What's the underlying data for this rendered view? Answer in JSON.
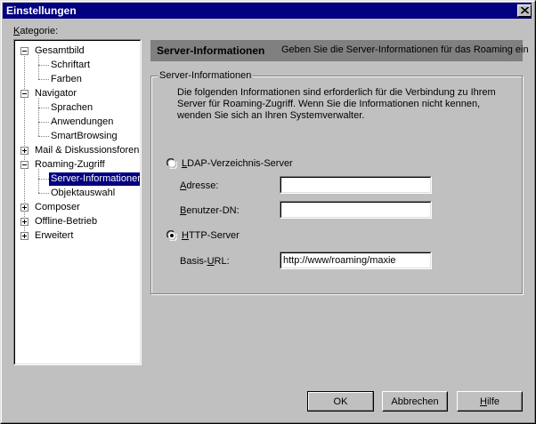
{
  "window": {
    "title": "Einstellungen"
  },
  "kategorie_label": "Kategorie:",
  "tree": {
    "gesamtbild": "Gesamtbild",
    "schriftart": "Schriftart",
    "farben": "Farben",
    "navigator": "Navigator",
    "sprachen": "Sprachen",
    "anwendungen": "Anwendungen",
    "smartbrowsing": "SmartBrowsing",
    "mail": "Mail & Diskussionsforen",
    "roaming": "Roaming-Zugriff",
    "server_info": "Server-Informationen",
    "objektauswahl": "Objektauswahl",
    "composer": "Composer",
    "offline": "Offline-Betrieb",
    "erweitert": "Erweitert"
  },
  "header": {
    "title": "Server-Informationen",
    "description": "Geben Sie die Server-Informationen für das Roaming ein"
  },
  "group": {
    "title": "Server-Informationen",
    "description": "Die folgenden Informationen sind erforderlich für die Verbindung zu Ihrem Server für Roaming-Zugriff. Wenn Sie die Informationen nicht kennen, wenden Sie sich an Ihren Systemverwalter.",
    "ldap_label": "LDAP-Verzeichnis-Server",
    "adresse_label": "Adresse:",
    "adresse_value": "",
    "benutzer_label": "Benutzer-DN:",
    "benutzer_value": "",
    "http_label": "HTTP-Server",
    "basis_label": "Basis-URL:",
    "basis_value": "http://www/roaming/maxie",
    "selected": "HTTP-Server"
  },
  "buttons": {
    "ok": "OK",
    "cancel": "Abbrechen",
    "help": "Hilfe"
  }
}
